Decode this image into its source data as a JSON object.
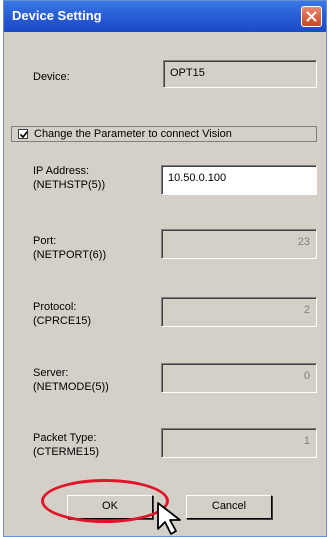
{
  "dialog": {
    "title": "Device Setting",
    "close_icon": "close-icon",
    "device_label": "Device:",
    "device_value": "OPT15",
    "checkbox_label": "Change the Parameter to connect Vision",
    "checkbox_checked": true,
    "fields": [
      {
        "label_line1": "IP Address:",
        "label_line2": "(NETHSTP(5))",
        "value": "10.50.0.100",
        "state": "editable"
      },
      {
        "label_line1": "Port:",
        "label_line2": "(NETPORT(6))",
        "value": "23",
        "state": "disabled"
      },
      {
        "label_line1": "Protocol:",
        "label_line2": "(CPRCE15)",
        "value": "2",
        "state": "disabled"
      },
      {
        "label_line1": "Server:",
        "label_line2": "(NETMODE(5))",
        "value": "0",
        "state": "disabled"
      },
      {
        "label_line1": "Packet Type:",
        "label_line2": "(CTERME15)",
        "value": "1",
        "state": "disabled"
      }
    ],
    "ok_label": "OK",
    "cancel_label": "Cancel",
    "highlight_color": "#e0152a"
  }
}
